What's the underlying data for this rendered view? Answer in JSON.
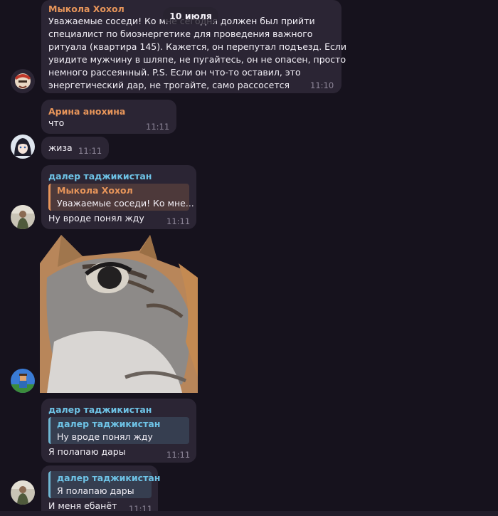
{
  "date_separator": "10 июля",
  "colors": {
    "name_orange": "#e7955a",
    "name_blue": "#6ec3e6",
    "quote_blue_bar": "#6fb7d3",
    "quote_orange_bar": "#e7955a"
  },
  "messages": [
    {
      "sender": "Мыкола Хохол",
      "lines": [
        "Уважаемые соседи! Ко мне сегодня должен был прийти",
        "специалист по биоэнергетике для проведения важного",
        "ритуала (квартира 145). Кажется, он перепутал подъезд. Если",
        "увидите мужчину в шляпе, не пугайтесь, он не опасен, просто",
        "немного рассеянный. P.S. Если он что-то оставил, это",
        "энергетический дар, не трогайте, само рассосется"
      ],
      "time": "11:10"
    },
    {
      "sender": "Арина анохина",
      "text": "что",
      "time": "11:11"
    },
    {
      "text": "жиза",
      "time": "11:11"
    },
    {
      "sender": "далер таджикистан",
      "quote": {
        "name": "Мыкола Хохол",
        "text": "Уважаемые соседи! Ко мне..."
      },
      "text": "Ну вроде понял жду",
      "time": "11:11"
    },
    {
      "photo": "cat-photo"
    },
    {
      "sender": "далер таджикистан",
      "quote": {
        "name": "далер таджикистан",
        "text": "Ну вроде понял жду"
      },
      "text": "Я полапаю дары",
      "time": "11:11"
    },
    {
      "quote": {
        "name": "далер таджикистан",
        "text": "Я полапаю дары"
      },
      "text": "И меня ебанёт",
      "time": "11:11"
    }
  ]
}
